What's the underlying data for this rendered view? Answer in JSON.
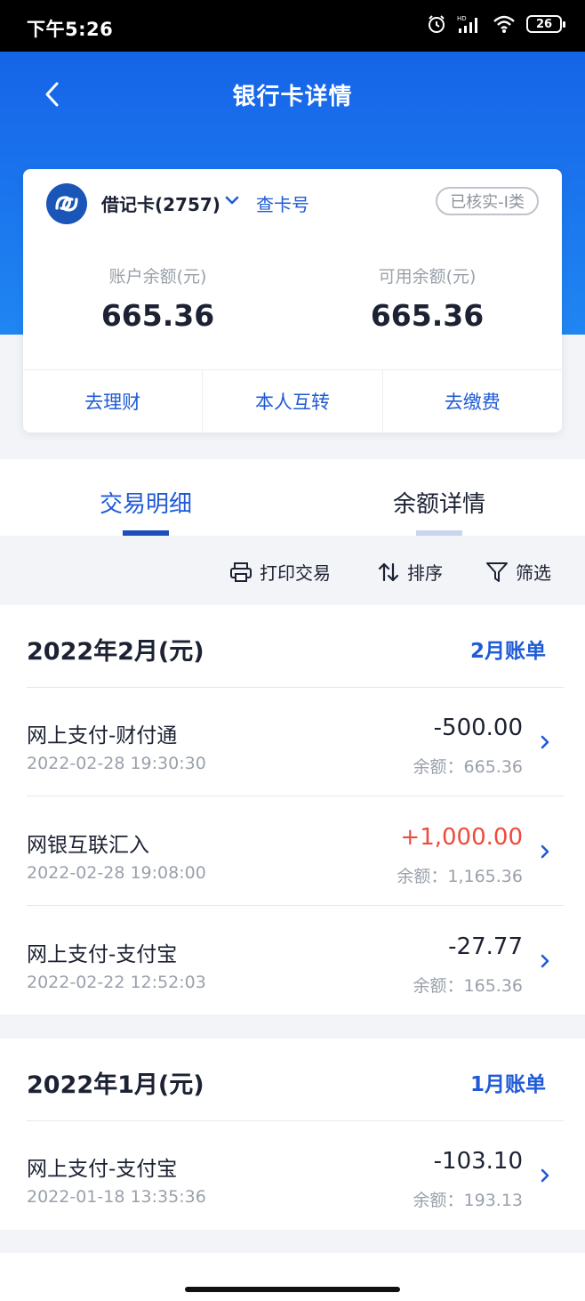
{
  "status_bar": {
    "time": "下午5:26",
    "battery": "26"
  },
  "header": {
    "title": "银行卡详情"
  },
  "card": {
    "type_label": "借记卡(2757)",
    "lookup_label": "查卡号",
    "verified_badge": "已核实-I类",
    "account_balance_label": "账户余额(元)",
    "account_balance": "665.36",
    "available_balance_label": "可用余额(元)",
    "available_balance": "665.36",
    "actions": [
      "去理财",
      "本人互转",
      "去缴费"
    ]
  },
  "tabs": {
    "active": "交易明细",
    "inactive": "余额详情"
  },
  "toolbar": {
    "print": "打印交易",
    "sort": "排序",
    "filter": "筛选"
  },
  "sections": [
    {
      "title": "2022年2月(元)",
      "link": "2月账单",
      "transactions": [
        {
          "name": "网上支付-财付通",
          "time": "2022-02-28 19:30:30",
          "amount": "-500.00",
          "balance": "余额：665.36"
        },
        {
          "name": "网银互联汇入",
          "time": "2022-02-28 19:08:00",
          "amount": "+1,000.00",
          "balance": "余额：1,165.36"
        },
        {
          "name": "网上支付-支付宝",
          "time": "2022-02-22 12:52:03",
          "amount": "-27.77",
          "balance": "余额：165.36"
        }
      ]
    },
    {
      "title": "2022年1月(元)",
      "link": "1月账单",
      "transactions": [
        {
          "name": "网上支付-支付宝",
          "time": "2022-01-18 13:35:36",
          "amount": "-103.10",
          "balance": "余额：193.13"
        }
      ]
    }
  ],
  "colors": {
    "brand_blue": "#1f5bd6",
    "header_top": "#1664e8",
    "header_bottom": "#1f86f2",
    "positive_amount": "#ee4b3b"
  }
}
